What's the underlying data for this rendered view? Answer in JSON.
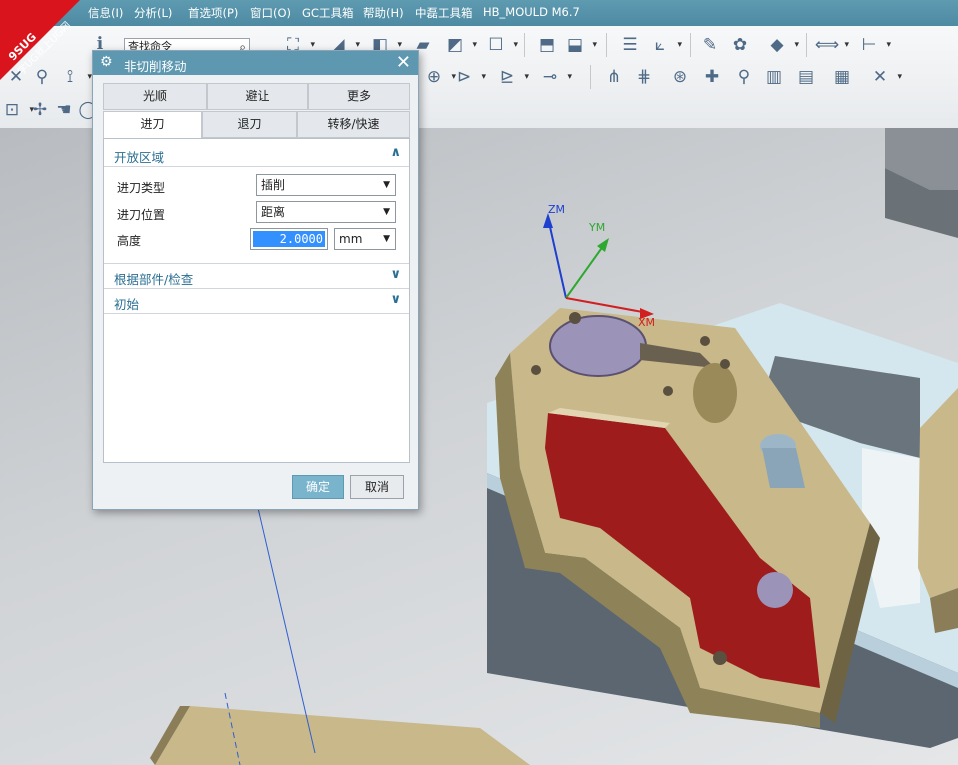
{
  "menubar": {
    "items": [
      "信息(I)",
      "分析(L)",
      "首选项(P)",
      "窗口(O)",
      "GC工具箱",
      "帮助(H)",
      "中磊工具箱",
      "HB_MOULD M6.7"
    ]
  },
  "badge": {
    "line1": "9SUG",
    "line2": "学UG就上UG网",
    "bg_color": "#d9141c"
  },
  "toolbar": {
    "search_placeholder": "查找命令"
  },
  "viewport": {
    "axes": {
      "z": "ZM",
      "y": "YM",
      "x": "XM"
    },
    "colors": {
      "part": "#c8b88a",
      "floor": "#9e1c1c",
      "block": "#5c6670",
      "hole": "#9c93b8"
    }
  },
  "dialog": {
    "title": "非切削移动",
    "tabs_row1": [
      "光顺",
      "避让",
      "更多"
    ],
    "tabs_row2": [
      "进刀",
      "退刀",
      "转移/快速"
    ],
    "active_tab": "进刀",
    "sections": {
      "open_area": "开放区域",
      "from_part_check": "根据部件/检查",
      "initial": "初始"
    },
    "fields": {
      "entry_type_label": "进刀类型",
      "entry_type_value": "插削",
      "entry_position_label": "进刀位置",
      "entry_position_value": "距离",
      "height_label": "高度",
      "height_value": "2.0000",
      "height_unit": "mm"
    },
    "buttons": {
      "ok": "确定",
      "cancel": "取消"
    }
  }
}
